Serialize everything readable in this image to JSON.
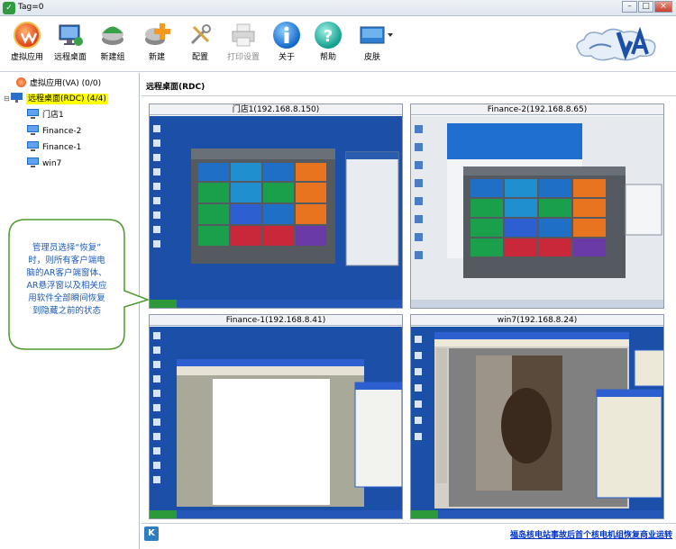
{
  "window": {
    "title": "Tag=0"
  },
  "toolbar": {
    "items": [
      {
        "label": "虚拟应用",
        "icon": "virtual-app-icon"
      },
      {
        "label": "远程桌面",
        "icon": "remote-desktop-icon"
      },
      {
        "label": "新建组",
        "icon": "new-group-icon"
      },
      {
        "label": "新建",
        "icon": "new-icon"
      },
      {
        "label": "配置",
        "icon": "config-tools-icon"
      },
      {
        "label": "打印设置",
        "icon": "printer-icon",
        "disabled": true
      },
      {
        "label": "关于",
        "icon": "info-icon"
      },
      {
        "label": "帮助",
        "icon": "help-icon"
      },
      {
        "label": "皮肤",
        "icon": "skin-icon"
      }
    ]
  },
  "sidebar": {
    "tree": [
      {
        "label": "虚拟应用(VA) (0/0)",
        "level": 0,
        "icon": "va-icon"
      },
      {
        "label": "远程桌面(RDC) (4/4)",
        "level": 0,
        "icon": "rdc-icon",
        "selected": true
      },
      {
        "label": "门店1",
        "level": 1,
        "icon": "monitor-icon"
      },
      {
        "label": "Finance-2",
        "level": 1,
        "icon": "monitor-icon"
      },
      {
        "label": "Finance-1",
        "level": 1,
        "icon": "monitor-icon"
      },
      {
        "label": "win7",
        "level": 1,
        "icon": "monitor-icon"
      }
    ]
  },
  "callout": {
    "lines": [
      "管理员选择“恢复”",
      "时，则所有客户端电",
      "脑的AR客户端窗体、",
      "AR悬浮窗以及相关应",
      "用软件全部瞬间恢复",
      "到隐藏之前的状态"
    ]
  },
  "main": {
    "header": "远程桌面(RDC)",
    "panels": [
      {
        "caption": "门店1(192.168.8.150)"
      },
      {
        "caption": "Finance-2(192.168.8.65)"
      },
      {
        "caption": "Finance-1(192.168.8.41)"
      },
      {
        "caption": "win7(192.168.8.24)"
      }
    ],
    "footer_link": "福岛核电站事故后首个核电机组恢复商业运转"
  },
  "colors": {
    "desktop_blue": "#1c4fa8",
    "tile_green": "#1aa04a",
    "tile_orange": "#e8741f",
    "tile_blue": "#1f6fc6",
    "tile_red": "#c8283a",
    "tile_purple": "#6a3aa6",
    "selection_yellow": "#ffff00",
    "callout_border": "#4c9a2a",
    "callout_text": "#1e5bb8"
  }
}
